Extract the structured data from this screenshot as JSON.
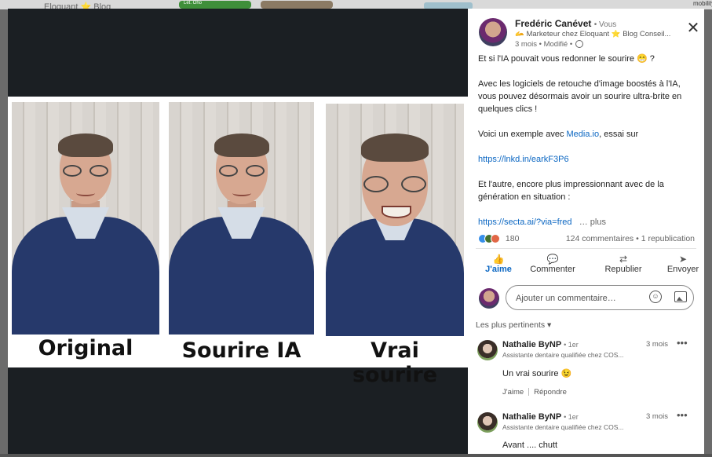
{
  "background": {
    "top_text": "Eloquant ⭐ Blog",
    "badge_text": "Let. Oho",
    "right_text": "mobility."
  },
  "captions": [
    "Original",
    "Sourire IA",
    "Vrai sourire"
  ],
  "post": {
    "author_name": "Fredéric Canévet",
    "author_suffix": "• Vous",
    "author_title": "🫴 Marketeur chez Eloquant ⭐ Blog Conseil...",
    "time": "3 mois • Modifié •",
    "paragraphs": [
      "Et si l'IA pouvait vous redonner le sourire 😁 ?",
      "Avec les logiciels de retouche d'image boostés à l'IA, vous pouvez désormais avoir un sourire ultra-brite en quelques clics !"
    ],
    "example_prefix": "Voici un exemple avec ",
    "example_link": "Media.io",
    "example_suffix": ", essai sur",
    "link1": "https://lnkd.in/earkF3P6",
    "paragraph3": "Et l'autre, encore plus impressionnant avec de la génération en situation :",
    "link2": "https://secta.ai/?via=fred",
    "more": "… plus"
  },
  "stats": {
    "reactions_count": "180",
    "comments_reposts": "124 commentaires • 1 republication"
  },
  "actions": {
    "like": "J'aime",
    "comment": "Commenter",
    "repost": "Republier",
    "send": "Envoyer"
  },
  "comment_input": {
    "placeholder": "Ajouter un commentaire…"
  },
  "sort_label": "Les plus pertinents ▾",
  "comments": [
    {
      "name": "Nathalie ByNP",
      "degree": "• 1er",
      "headline": "Assistante dentaire qualifiée chez COS...",
      "time": "3 mois",
      "text": "Un vrai sourire 😉",
      "like": "J'aime",
      "reply": "Répondre"
    },
    {
      "name": "Nathalie ByNP",
      "degree": "• 1er",
      "headline": "Assistante dentaire qualifiée chez COS...",
      "time": "3 mois",
      "text": "Avant .... chutt"
    }
  ],
  "icons": [
    "close-icon",
    "globe-icon",
    "like-icon",
    "comment-icon",
    "repost-icon",
    "send-icon",
    "emoji-icon",
    "image-icon",
    "more-icon"
  ]
}
